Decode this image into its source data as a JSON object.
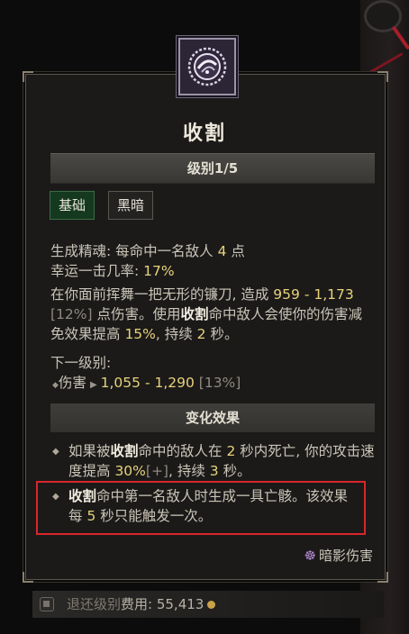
{
  "skill": {
    "name": "收割",
    "rank": "级别1/5",
    "tabs": [
      "基础",
      "黑暗"
    ],
    "stats": {
      "essence_label": "生成精魂: 每命中一名敌人 ",
      "essence_value": "4",
      "essence_suffix": " 点",
      "lucky_label": "幸运一击几率: ",
      "lucky_value": "17%"
    },
    "description": {
      "p1": "在你面前挥舞一把无形的镰刀, 造成 ",
      "dmg_low": "959",
      "dash": " - ",
      "dmg_high": "1,173",
      "bracket": " [12%]",
      "p2": " 点伤害。使用",
      "skill_ref": "收割",
      "p3": "命中敌人会使你的伤害减免效果提高 ",
      "dr": "15%",
      "p4": ", 持续 ",
      "dur": "2",
      "p5": " 秒。"
    },
    "next_rank": {
      "label": "下一级别:",
      "dmg_label": "伤害",
      "range": "1,055 - 1,290",
      "pct": "[13%]"
    },
    "modifier_header": "变化效果",
    "modifiers": [
      {
        "a": "如果被",
        "ref": "收割",
        "b": "命中的敌人在 ",
        "v1": "2",
        "c": " 秒内死亡, 你的攻击速度提高 ",
        "v2": "30%",
        "plus": "[+]",
        "d": ", 持续 ",
        "v3": "3",
        "e": " 秒。"
      },
      {
        "ref": "收割",
        "a": "命中第一名敌人时生成一具亡骸。该效果每 ",
        "v1": "5",
        "b": " 秒只能触发一次。"
      }
    ],
    "damage_type": "暗影伤害"
  },
  "footer": {
    "label": "退还级别",
    "cost_label": "费用: ",
    "cost_value": "55,413"
  },
  "colors": {
    "highlight": "#e8d27b",
    "annotation_box": "#d8262c",
    "basic_tab": "#15391f"
  },
  "icons": [
    "reap-skill-icon",
    "shadow-damage-icon",
    "key-icon",
    "gold-coin-icon"
  ]
}
